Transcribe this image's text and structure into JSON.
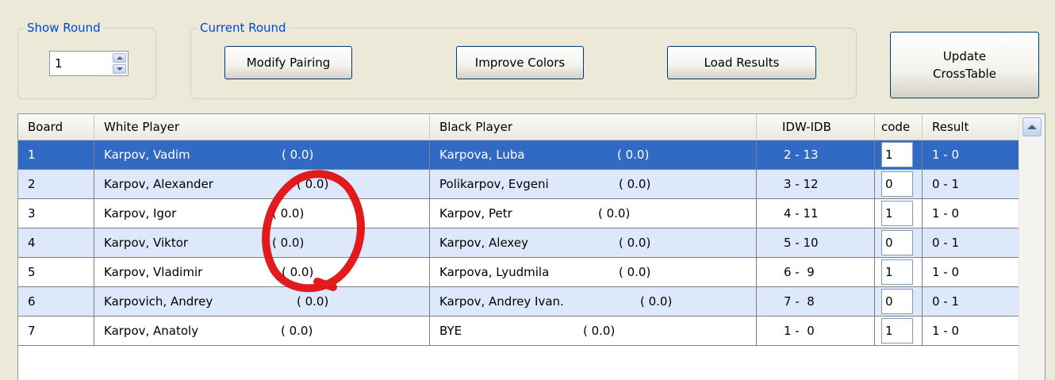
{
  "show_round": {
    "legend": "Show Round",
    "value": "1"
  },
  "current_round": {
    "legend": "Current Round",
    "modify_pairing": "Modify Pairing",
    "improve_colors": "Improve Colors",
    "load_results": "Load Results"
  },
  "update_button": "Update\nCrossTable",
  "table": {
    "headers": {
      "board": "Board",
      "white": "White Player",
      "black": "Black Player",
      "idw": "IDW-IDB",
      "code": "code",
      "result": "Result"
    },
    "rows": [
      {
        "board": "1",
        "white": "Karpov, Vadim",
        "white_score": "( 0.0)",
        "black": "Karpova, Luba",
        "black_score": "( 0.0)",
        "idw": "2 - 13",
        "code": "1",
        "result": "1 - 0"
      },
      {
        "board": "2",
        "white": "Karpov, Alexander",
        "white_score": "( 0.0)",
        "black": "Polikarpov, Evgeni",
        "black_score": "( 0.0)",
        "idw": "3 - 12",
        "code": "0",
        "result": "0 - 1"
      },
      {
        "board": "3",
        "white": "Karpov, Igor",
        "white_score": "( 0.0)",
        "black": "Karpov, Petr",
        "black_score": "( 0.0)",
        "idw": "4 - 11",
        "code": "1",
        "result": "1 - 0"
      },
      {
        "board": "4",
        "white": "Karpov, Viktor",
        "white_score": "( 0.0)",
        "black": "Karpov, Alexey",
        "black_score": "( 0.0)",
        "idw": "5 - 10",
        "code": "0",
        "result": "0 - 1"
      },
      {
        "board": "5",
        "white": "Karpov, Vladimir",
        "white_score": "( 0.0)",
        "black": "Karpova, Lyudmila",
        "black_score": "( 0.0)",
        "idw": "6 -  9",
        "code": "1",
        "result": "1 - 0"
      },
      {
        "board": "6",
        "white": "Karpovich, Andrey",
        "white_score": "( 0.0)",
        "black": "Karpov, Andrey Ivan.",
        "black_score": "( 0.0)",
        "idw": "7 -  8",
        "code": "0",
        "result": "0 - 1"
      },
      {
        "board": "7",
        "white": "Karpov, Anatoly",
        "white_score": "( 0.0)",
        "black": "BYE",
        "black_score": "( 0.0)",
        "idw": "1 -  0",
        "code": "1",
        "result": "1 - 0"
      }
    ]
  },
  "icons": {
    "spin_up": "triangle-up-icon",
    "spin_down": "triangle-down-icon",
    "scroll_up": "triangle-up-icon"
  },
  "colors": {
    "selection": "#316ac5",
    "alt_row": "#dde9fa",
    "legend_text": "#0046d5",
    "annotation": "#e01010"
  }
}
